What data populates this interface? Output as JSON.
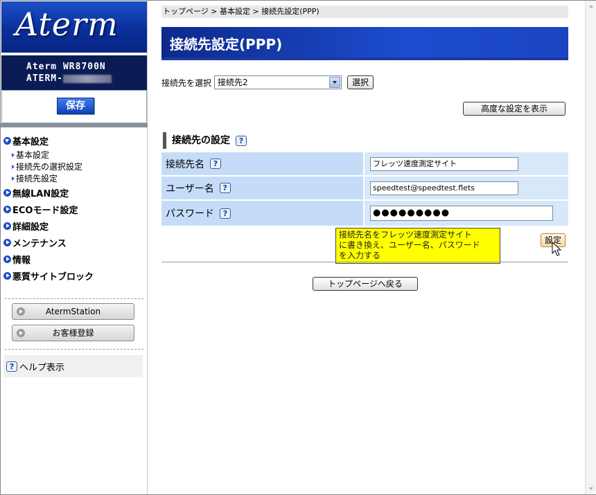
{
  "sidebar": {
    "logo": "Aterm",
    "model_line1": "Aterm WR8700N",
    "model_line2_prefix": "ATERM-",
    "save_label": "保存",
    "nav": [
      {
        "label": "基本設定",
        "icon": "circle-down-icon",
        "expanded": true,
        "children": [
          "基本設定",
          "接続先の選択設定",
          "接続先設定"
        ]
      },
      {
        "label": "無線LAN設定",
        "icon": "circle-right-icon"
      },
      {
        "label": "ECOモード設定",
        "icon": "circle-right-icon"
      },
      {
        "label": "詳細設定",
        "icon": "circle-right-icon"
      },
      {
        "label": "メンテナンス",
        "icon": "circle-right-icon"
      },
      {
        "label": "情報",
        "icon": "circle-right-icon"
      },
      {
        "label": "悪質サイトブロック",
        "icon": "circle-right-icon"
      }
    ],
    "aterm_station_label": "AtermStation",
    "registration_label": "お客様登録",
    "help_label": "ヘルプ表示",
    "help_icon_text": "?"
  },
  "main": {
    "breadcrumb": "トップページ > 基本設定 > 接続先設定(PPP)",
    "title": "接続先設定(PPP)",
    "select_label": "接続先を選択",
    "select_value": "接続先2",
    "choose_label": "選択",
    "advanced_label": "高度な設定を表示",
    "section_title": "接続先の設定",
    "fields": {
      "name_label": "接続先名",
      "name_value": "フレッツ速度測定サイト",
      "user_label": "ユーザー名",
      "user_value": "speedtest@speedtest.flets",
      "password_label": "パスワード",
      "password_value": "●●●●●●●●●"
    },
    "set_label": "設定",
    "back_label": "トップページへ戻る",
    "tooltip": {
      "line1": "接続先名をフレッツ速度測定サイト",
      "line2": "に書き換え、ユーザー名、パスワード",
      "line3": "を入力する"
    }
  },
  "colors": {
    "brand_blue": "#1b4fc4",
    "label_cell": "#c4dcf8",
    "value_cell": "#d8e8fb",
    "tooltip": "#ffff00"
  }
}
